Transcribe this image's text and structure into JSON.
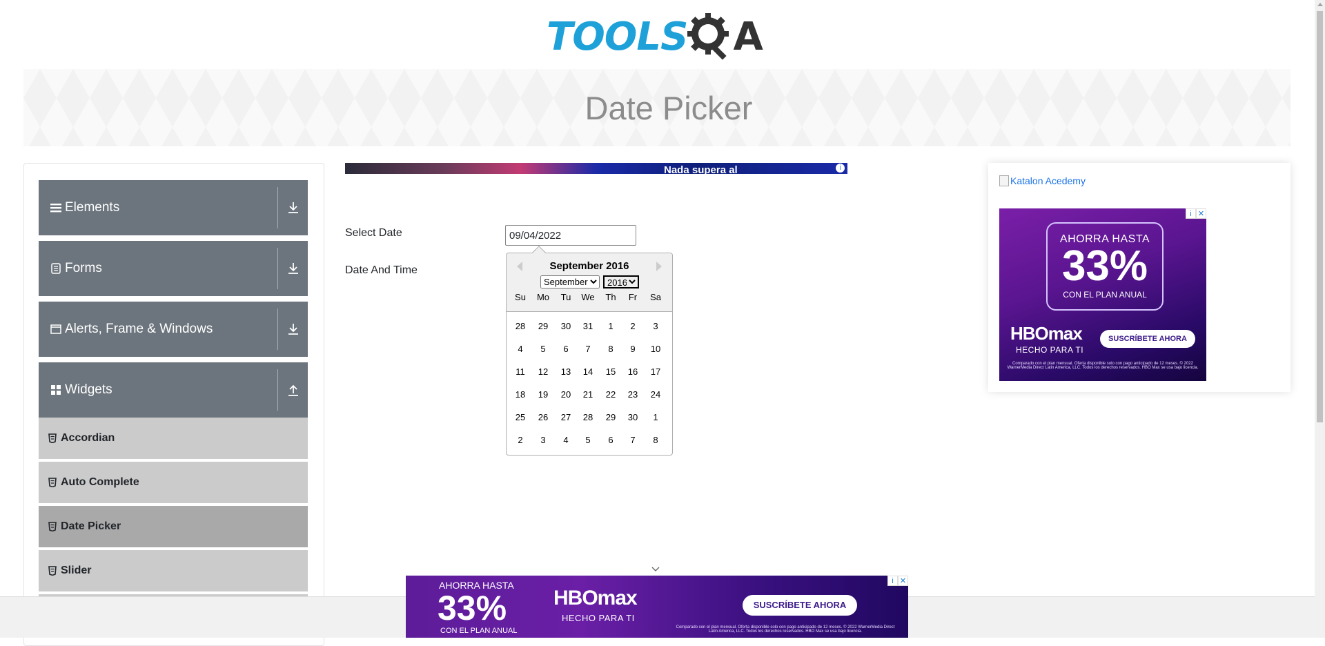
{
  "header": {
    "logo_text": "TOOLS",
    "logo_tail": "A"
  },
  "banner": {
    "title": "Date Picker"
  },
  "sidebar": {
    "groups": [
      {
        "label": "Elements",
        "icon": "hamburger-icon"
      },
      {
        "label": "Forms",
        "icon": "form-icon"
      },
      {
        "label": "Alerts, Frame & Windows",
        "icon": "window-icon"
      },
      {
        "label": "Widgets",
        "icon": "grid-icon"
      }
    ],
    "items": [
      {
        "label": "Accordian"
      },
      {
        "label": "Auto Complete"
      },
      {
        "label": "Date Picker",
        "active": true
      },
      {
        "label": "Slider"
      }
    ]
  },
  "top_ad": {
    "text": "Nada supera al"
  },
  "form": {
    "select_date_label": "Select Date",
    "date_value": "09/04/2022",
    "date_time_label": "Date And Time"
  },
  "calendar": {
    "title": "September 2016",
    "month_select": "September",
    "year_select": "2016",
    "weekdays": [
      "Su",
      "Mo",
      "Tu",
      "We",
      "Th",
      "Fr",
      "Sa"
    ],
    "weeks": [
      [
        "28",
        "29",
        "30",
        "31",
        "1",
        "2",
        "3"
      ],
      [
        "4",
        "5",
        "6",
        "7",
        "8",
        "9",
        "10"
      ],
      [
        "11",
        "12",
        "13",
        "14",
        "15",
        "16",
        "17"
      ],
      [
        "18",
        "19",
        "20",
        "21",
        "22",
        "23",
        "24"
      ],
      [
        "25",
        "26",
        "27",
        "28",
        "29",
        "30",
        "1"
      ],
      [
        "2",
        "3",
        "4",
        "5",
        "6",
        "7",
        "8"
      ]
    ]
  },
  "right_ad": {
    "alt_text": "Katalon Acedemy",
    "line1": "AHORRA HASTA",
    "percent": "33%",
    "line2": "CON EL PLAN ANUAL",
    "brand": "HBOmax",
    "tagline": "HECHO PARA TI",
    "cta": "SUSCRÍBETE AHORA",
    "fine_print": "Comparado con el plan mensual. Oferta disponible solo con pago anticipado de 12 meses. © 2022 WarnerMedia Direct Latin America, LLC. Todos los derechos reservados. HBO Max se usa bajo licencia."
  },
  "bottom_ad": {
    "line1": "AHORRA HASTA",
    "percent": "33%",
    "line2": "CON EL PLAN ANUAL",
    "brand": "HBOmax",
    "tagline": "HECHO PARA TI",
    "cta": "SUSCRÍBETE AHORA",
    "fine_print": "Comparado con el plan mensual. Oferta disponible solo con pago anticipado de 12 meses. © 2022 WarnerMedia Direct Latin America, LLC. Todos los derechos reservados. HBO Max se usa bajo licencia."
  },
  "colors": {
    "accent": "#1ea1d9",
    "sidebar_group": "#6c757d",
    "sidebar_item": "#cbcbcb",
    "sidebar_active": "#a9a9a9"
  }
}
